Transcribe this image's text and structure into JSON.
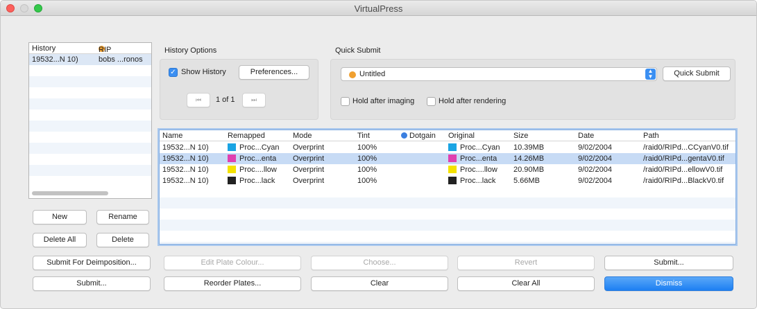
{
  "window": {
    "title": "VirtualPress"
  },
  "history": {
    "columns": [
      "History",
      "RIP"
    ],
    "rows": [
      {
        "history": "19532...N 10)",
        "rip": "bobs ...ronos"
      }
    ]
  },
  "left_buttons": {
    "new": "New",
    "rename": "Rename",
    "delete_all": "Delete All",
    "delete": "Delete",
    "submit_for_deimposition": "Submit For Deimposition...",
    "submit": "Submit..."
  },
  "history_options": {
    "label": "History Options",
    "show_history_label": "Show History",
    "show_history_checked": true,
    "preferences": "Preferences...",
    "first_icon": "skip-back-icon",
    "first_glyph": "⏮",
    "page": "1 of 1",
    "last_icon": "skip-forward-icon",
    "last_glyph": "⏭"
  },
  "quick_submit": {
    "label": "Quick Submit",
    "selected": "Untitled",
    "button": "Quick Submit",
    "hold_imaging": "Hold after imaging",
    "hold_rendering": "Hold after rendering"
  },
  "plates": {
    "columns": {
      "name": "Name",
      "remapped": "Remapped",
      "mode": "Mode",
      "tint": "Tint",
      "dotgain": "Dotgain",
      "original": "Original",
      "size": "Size",
      "date": "Date",
      "path": "Path"
    },
    "rows": [
      {
        "name": "19532...N 10)",
        "remapped": "Proc...Cyan",
        "color": "#1aa4e3",
        "mode": "Overprint",
        "tint": "100%",
        "original": "Proc...Cyan",
        "size": "10.39MB",
        "date": "9/02/2004",
        "path": "/raid0/RIPd...CCyanV0.tif"
      },
      {
        "name": "19532...N 10)",
        "remapped": "Proc...enta",
        "color": "#e040b0",
        "mode": "Overprint",
        "tint": "100%",
        "original": "Proc...enta",
        "size": "14.26MB",
        "date": "9/02/2004",
        "path": "/raid0/RIPd...gentaV0.tif"
      },
      {
        "name": "19532...N 10)",
        "remapped": "Proc....llow",
        "color": "#f4e200",
        "mode": "Overprint",
        "tint": "100%",
        "original": "Proc....llow",
        "size": "20.90MB",
        "date": "9/02/2004",
        "path": "/raid0/RIPd...ellowV0.tif"
      },
      {
        "name": "19532...N 10)",
        "remapped": "Proc...lack",
        "color": "#222222",
        "mode": "Overprint",
        "tint": "100%",
        "original": "Proc...lack",
        "size": "5.66MB",
        "date": "9/02/2004",
        "path": "/raid0/RIPd...BlackV0.tif"
      }
    ],
    "selected_row": 1
  },
  "bottom_buttons": {
    "edit_plate_colour": "Edit Plate Colour...",
    "choose": "Choose...",
    "revert": "Revert",
    "submit": "Submit...",
    "reorder_plates": "Reorder Plates...",
    "clear": "Clear",
    "clear_all": "Clear All",
    "dismiss": "Dismiss"
  },
  "colors": {
    "accent": "#1d7ff2",
    "rip_dot": "#f0a030",
    "dotgain_dot": "#3b7fe0"
  }
}
